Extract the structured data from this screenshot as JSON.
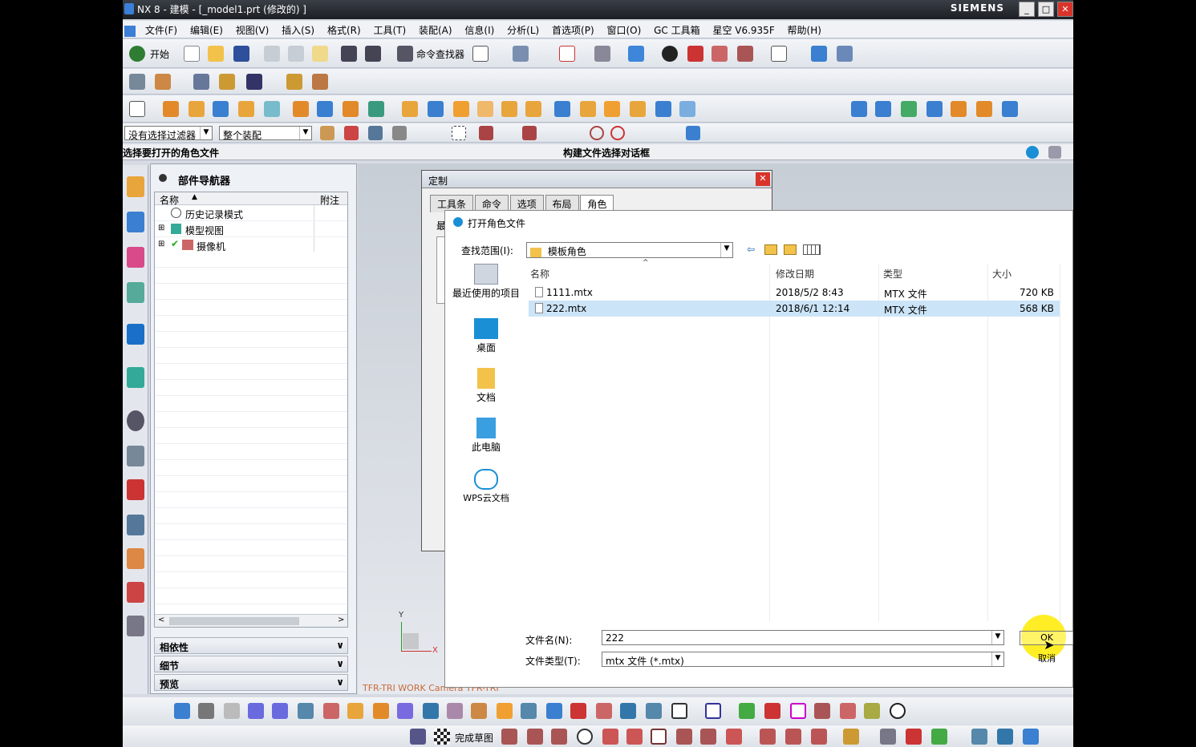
{
  "titlebar": {
    "title": "NX 8 - 建模 - [_model1.prt  (修改的) ]",
    "brand": "SIEMENS",
    "minimize": "_",
    "maximize": "□",
    "close": "✕"
  },
  "menu": [
    "文件(F)",
    "编辑(E)",
    "视图(V)",
    "插入(S)",
    "格式(R)",
    "工具(T)",
    "装配(A)",
    "信息(I)",
    "分析(L)",
    "首选项(P)",
    "窗口(O)",
    "GC 工具箱",
    "星空 V6.935F",
    "帮助(H)"
  ],
  "toolbar": {
    "start": "开始",
    "command_finder": "命令查找器",
    "filter": "没有选择过滤器",
    "scope": "整个装配"
  },
  "status": {
    "left": "选择要打开的角色文件",
    "center": "构建文件选择对话框"
  },
  "navigator": {
    "title": "部件导航器",
    "col_name": "名称",
    "col_note": "附注",
    "items": [
      "历史记录模式",
      "模型视图",
      "摄像机"
    ],
    "sections": [
      "相依性",
      "细节",
      "预览"
    ]
  },
  "viewport": {
    "camera_label": "TFR-TRI WORK Camera TFR-TRI",
    "axis_y": "Y",
    "axis_x": "X"
  },
  "customize_dialog": {
    "title": "定制",
    "tabs": [
      "工具条",
      "命令",
      "选项",
      "布局",
      "角色"
    ],
    "partial_label": "最"
  },
  "open_dialog": {
    "title": "打开角色文件",
    "look_in_label": "查找范围(I):",
    "look_in_value": "模板角色",
    "places": [
      "最近使用的项目",
      "桌面",
      "文档",
      "此电脑",
      "WPS云文档"
    ],
    "columns": [
      "名称",
      "修改日期",
      "类型",
      "大小"
    ],
    "files": [
      {
        "name": "1111.mtx",
        "date": "2018/5/2 8:43",
        "type": "MTX 文件",
        "size": "720 KB"
      },
      {
        "name": "222.mtx",
        "date": "2018/6/1 12:14",
        "type": "MTX 文件",
        "size": "568 KB"
      }
    ],
    "filename_label": "文件名(N):",
    "filename_value": "222",
    "filetype_label": "文件类型(T):",
    "filetype_value": "mtx 文件 (*.mtx)",
    "ok": "OK",
    "cancel": "取消"
  },
  "sketch_bar": {
    "finish_sketch": "完成草图"
  },
  "colors": {
    "selection": "#cce4f7",
    "titlebar": "#1c1f24",
    "highlight": "#ffeb00"
  }
}
